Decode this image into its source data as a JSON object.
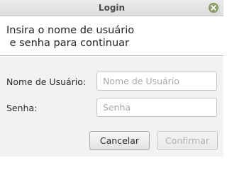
{
  "window": {
    "title": "Login"
  },
  "header": {
    "line1": "Insira o nome de usuário",
    "line2": " e senha para continuar"
  },
  "form": {
    "username_label": "Nome de Usuário:",
    "username_value": "",
    "username_placeholder": "Nome de Usuário",
    "password_label": "Senha:",
    "password_value": "",
    "password_placeholder": "Senha"
  },
  "buttons": {
    "cancel_label": "Cancelar",
    "confirm_label": "Confirmar",
    "confirm_enabled": false
  },
  "colors": {
    "close_button": "#8fa46a",
    "content_background": "#f2f2f2",
    "disabled_text": "#b0b0b0"
  },
  "icons": {
    "close": "close-icon"
  }
}
